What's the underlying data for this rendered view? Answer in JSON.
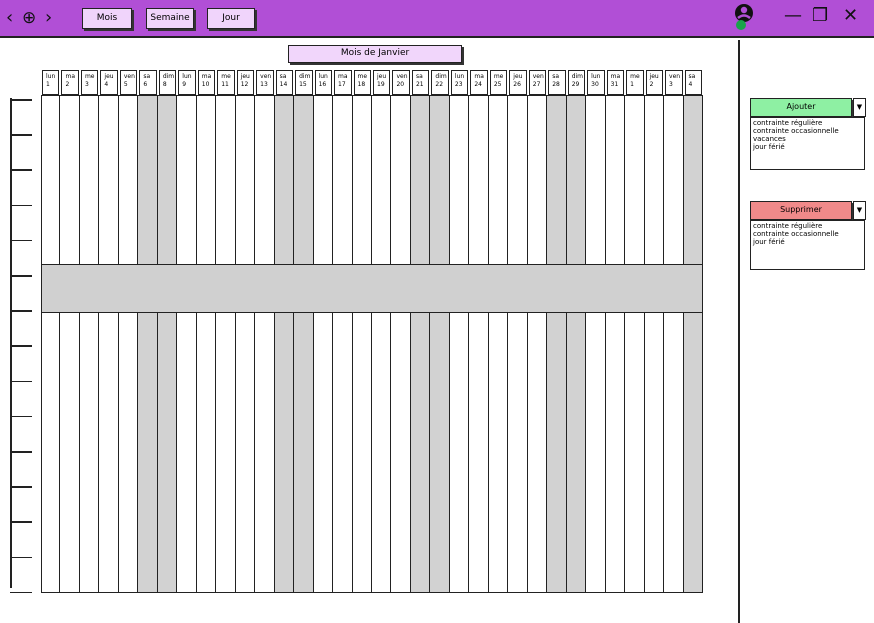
{
  "toolbar": {
    "prev_glyph": "‹",
    "target_glyph": "⊕",
    "next_glyph": "›",
    "views": [
      "Mois",
      "Semaine",
      "Jour"
    ]
  },
  "window": {
    "minimize_glyph": "—",
    "restore_glyph": "❐",
    "close_glyph": "✕"
  },
  "calendar": {
    "title": "Mois de Janvier",
    "days": [
      {
        "name": "lun",
        "num": "1",
        "weekend": false
      },
      {
        "name": "ma",
        "num": "2",
        "weekend": false
      },
      {
        "name": "me",
        "num": "3",
        "weekend": false
      },
      {
        "name": "jeu",
        "num": "4",
        "weekend": false
      },
      {
        "name": "ven",
        "num": "5",
        "weekend": false
      },
      {
        "name": "sa",
        "num": "6",
        "weekend": true
      },
      {
        "name": "dim",
        "num": "8",
        "weekend": true
      },
      {
        "name": "lun",
        "num": "9",
        "weekend": false
      },
      {
        "name": "ma",
        "num": "10",
        "weekend": false
      },
      {
        "name": "me",
        "num": "11",
        "weekend": false
      },
      {
        "name": "jeu",
        "num": "12",
        "weekend": false
      },
      {
        "name": "ven",
        "num": "13",
        "weekend": false
      },
      {
        "name": "sa",
        "num": "14",
        "weekend": true
      },
      {
        "name": "dim",
        "num": "15",
        "weekend": true
      },
      {
        "name": "lun",
        "num": "16",
        "weekend": false
      },
      {
        "name": "ma",
        "num": "17",
        "weekend": false
      },
      {
        "name": "me",
        "num": "18",
        "weekend": false
      },
      {
        "name": "jeu",
        "num": "19",
        "weekend": false
      },
      {
        "name": "ven",
        "num": "20",
        "weekend": false
      },
      {
        "name": "sa",
        "num": "21",
        "weekend": true
      },
      {
        "name": "dim",
        "num": "22",
        "weekend": true
      },
      {
        "name": "lun",
        "num": "23",
        "weekend": false
      },
      {
        "name": "ma",
        "num": "24",
        "weekend": false
      },
      {
        "name": "me",
        "num": "25",
        "weekend": false
      },
      {
        "name": "jeu",
        "num": "26",
        "weekend": false
      },
      {
        "name": "ven",
        "num": "27",
        "weekend": false
      },
      {
        "name": "sa",
        "num": "28",
        "weekend": true
      },
      {
        "name": "dim",
        "num": "29",
        "weekend": true
      },
      {
        "name": "lun",
        "num": "30",
        "weekend": false
      },
      {
        "name": "ma",
        "num": "31",
        "weekend": false
      },
      {
        "name": "me",
        "num": "1",
        "weekend": false
      },
      {
        "name": "jeu",
        "num": "2",
        "weekend": false
      },
      {
        "name": "ven",
        "num": "3",
        "weekend": false
      },
      {
        "name": "sa",
        "num": "4",
        "weekend": true
      }
    ]
  },
  "sidebar": {
    "add": {
      "label": "Ajouter",
      "toggle": "▼",
      "options": [
        "contrainte régulière",
        "contrainte occasionnelle",
        "vacances",
        "jour férié"
      ]
    },
    "remove": {
      "label": "Supprimer",
      "toggle": "▼",
      "options": [
        "contrainte régulière",
        "contrainte occasionnelle",
        "jour férié"
      ]
    }
  },
  "colors": {
    "header_bg": "#b14fd6",
    "view_button_bg": "#f0d4fb",
    "weekend_bg": "#d2d2d2",
    "add_bg": "#8ef0a3",
    "remove_bg": "#f08a8a",
    "avatar_status": "#1aa34a"
  }
}
